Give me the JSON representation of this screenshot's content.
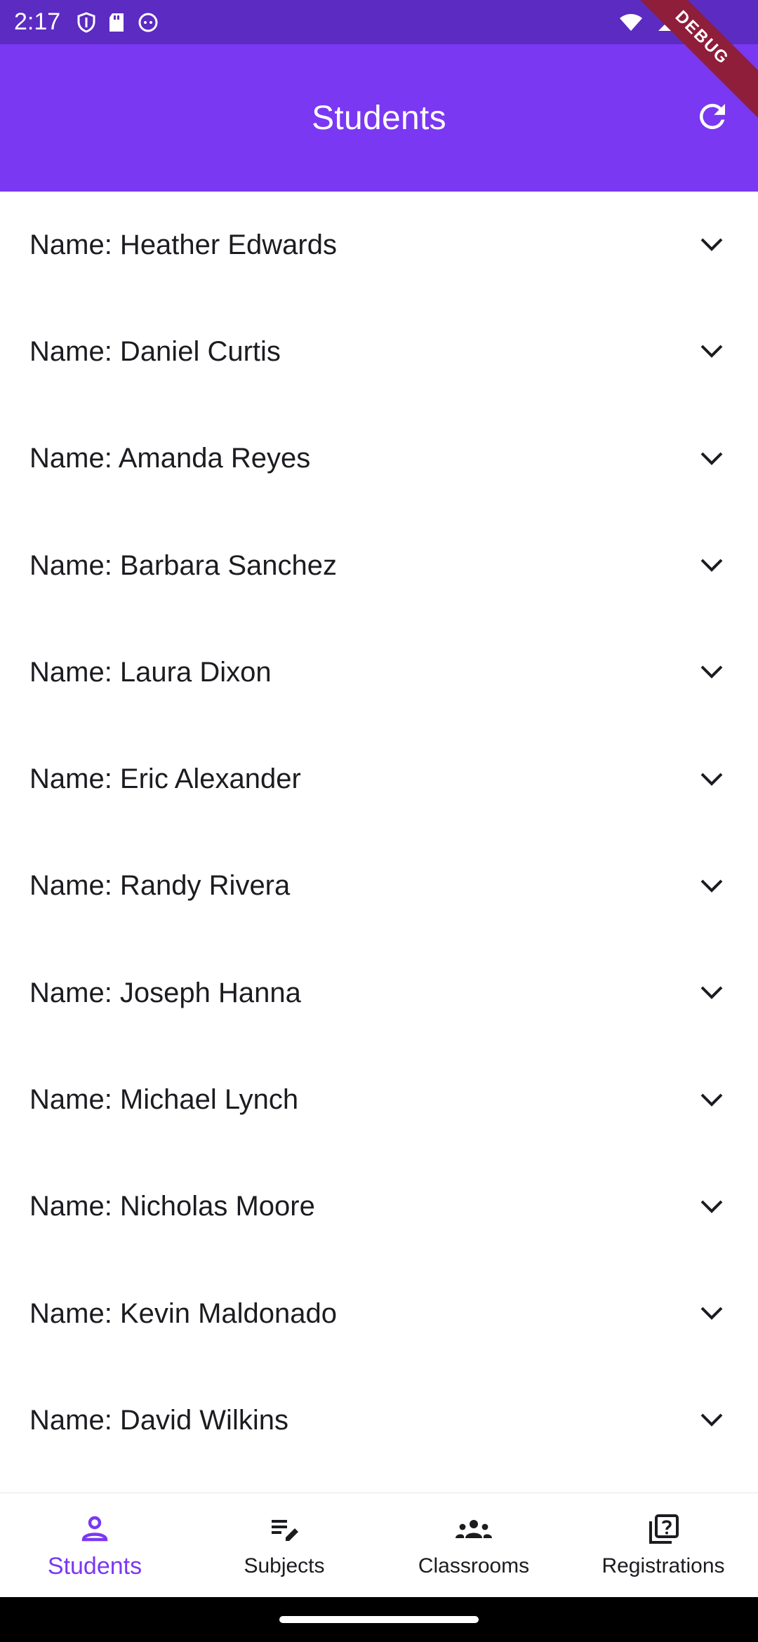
{
  "status_bar": {
    "time": "2:17"
  },
  "app_bar": {
    "title": "Students",
    "debug_label": "DEBUG"
  },
  "students": [
    {
      "label": "Name: Heather Edwards"
    },
    {
      "label": "Name: Daniel Curtis"
    },
    {
      "label": "Name: Amanda Reyes"
    },
    {
      "label": "Name: Barbara Sanchez"
    },
    {
      "label": "Name: Laura Dixon"
    },
    {
      "label": "Name: Eric Alexander"
    },
    {
      "label": "Name: Randy Rivera"
    },
    {
      "label": "Name: Joseph Hanna"
    },
    {
      "label": "Name: Michael Lynch"
    },
    {
      "label": "Name: Nicholas Moore"
    },
    {
      "label": "Name: Kevin Maldonado"
    },
    {
      "label": "Name: David Wilkins"
    }
  ],
  "bottom_nav": {
    "items": [
      {
        "label": "Students",
        "icon": "person-icon",
        "active": true
      },
      {
        "label": "Subjects",
        "icon": "edit-note-icon",
        "active": false
      },
      {
        "label": "Classrooms",
        "icon": "groups-icon",
        "active": false
      },
      {
        "label": "Registrations",
        "icon": "quiz-icon",
        "active": false
      }
    ]
  },
  "colors": {
    "app_bar": "#7a38f2",
    "status_bar": "#5b2bc2",
    "active_nav": "#7a38f2",
    "debug_ribbon": "#8e1e3a"
  }
}
